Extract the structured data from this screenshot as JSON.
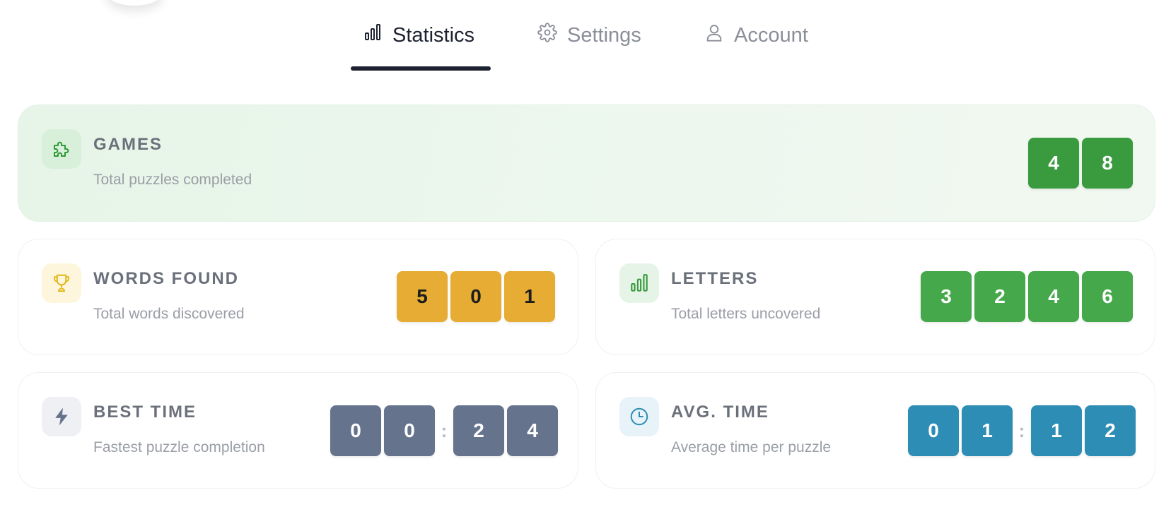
{
  "tabs": {
    "statistics": {
      "label": "Statistics",
      "icon": "bar-chart-icon",
      "active": true
    },
    "settings": {
      "label": "Settings",
      "icon": "gear-icon"
    },
    "account": {
      "label": "Account",
      "icon": "user-icon"
    }
  },
  "colors": {
    "games_digit": "#3a9a3e",
    "words_digit": "#e6ac33",
    "letters_digit": "#45a84a",
    "best_time_digit": "#66738d",
    "avg_time_digit": "#2e8db5",
    "active_tab": "#1d2230"
  },
  "cards": {
    "games": {
      "title": "GAMES",
      "subtitle": "Total puzzles completed",
      "icon": "puzzle-icon",
      "digits": [
        "4",
        "8"
      ]
    },
    "words_found": {
      "title": "WORDS FOUND",
      "subtitle": "Total words discovered",
      "icon": "trophy-icon",
      "digits": [
        "5",
        "0",
        "1"
      ]
    },
    "letters": {
      "title": "LETTERS",
      "subtitle": "Total letters uncovered",
      "icon": "bar-chart-icon",
      "digits": [
        "3",
        "2",
        "4",
        "6"
      ]
    },
    "best_time": {
      "title": "BEST TIME",
      "subtitle": "Fastest puzzle completion",
      "icon": "lightning-icon",
      "digits": [
        "0",
        "0",
        "2",
        "4"
      ],
      "separator": ":"
    },
    "avg_time": {
      "title": "AVG. TIME",
      "subtitle": "Average time per puzzle",
      "icon": "clock-icon",
      "digits": [
        "0",
        "1",
        "1",
        "2"
      ],
      "separator": ":"
    }
  }
}
